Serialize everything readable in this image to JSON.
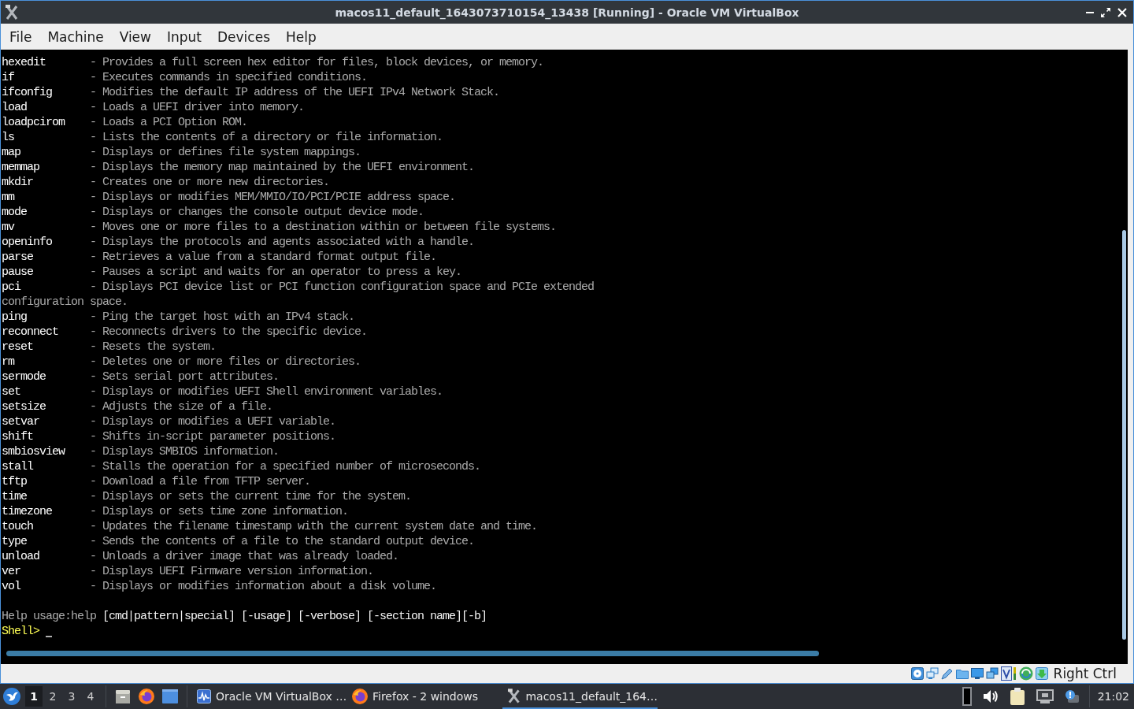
{
  "window": {
    "title": "macos11_default_1643073710154_13438 [Running] - Oracle VM VirtualBox"
  },
  "menu": [
    "File",
    "Machine",
    "View",
    "Input",
    "Devices",
    "Help"
  ],
  "terminal": {
    "lines": [
      {
        "command": "hexedit",
        "description": "- Provides a full screen hex editor for files, block devices, or memory."
      },
      {
        "command": "if",
        "description": "- Executes commands in specified conditions."
      },
      {
        "command": "ifconfig",
        "description": "- Modifies the default IP address of the UEFI IPv4 Network Stack."
      },
      {
        "command": "load",
        "description": "- Loads a UEFI driver into memory."
      },
      {
        "command": "loadpcirom",
        "description": "- Loads a PCI Option ROM."
      },
      {
        "command": "ls",
        "description": "- Lists the contents of a directory or file information."
      },
      {
        "command": "map",
        "description": "- Displays or defines file system mappings."
      },
      {
        "command": "memmap",
        "description": "- Displays the memory map maintained by the UEFI environment."
      },
      {
        "command": "mkdir",
        "description": "- Creates one or more new directories."
      },
      {
        "command": "mm",
        "description": "- Displays or modifies MEM/MMIO/IO/PCI/PCIE address space."
      },
      {
        "command": "mode",
        "description": "- Displays or changes the console output device mode."
      },
      {
        "command": "mv",
        "description": "- Moves one or more files to a destination within or between file systems."
      },
      {
        "command": "openinfo",
        "description": "- Displays the protocols and agents associated with a handle."
      },
      {
        "command": "parse",
        "description": "- Retrieves a value from a standard format output file."
      },
      {
        "command": "pause",
        "description": "- Pauses a script and waits for an operator to press a key."
      },
      {
        "command": "pci",
        "description": "- Displays PCI device list or PCI function configuration space and PCIe extended",
        "continuation": "configuration space."
      },
      {
        "command": "ping",
        "description": "- Ping the target host with an IPv4 stack."
      },
      {
        "command": "reconnect",
        "description": "- Reconnects drivers to the specific device."
      },
      {
        "command": "reset",
        "description": "- Resets the system."
      },
      {
        "command": "rm",
        "description": "- Deletes one or more files or directories."
      },
      {
        "command": "sermode",
        "description": "- Sets serial port attributes."
      },
      {
        "command": "set",
        "description": "- Displays or modifies UEFI Shell environment variables."
      },
      {
        "command": "setsize",
        "description": "- Adjusts the size of a file."
      },
      {
        "command": "setvar",
        "description": "- Displays or modifies a UEFI variable."
      },
      {
        "command": "shift",
        "description": "- Shifts in-script parameter positions."
      },
      {
        "command": "smbiosview",
        "description": "- Displays SMBIOS information."
      },
      {
        "command": "stall",
        "description": "- Stalls the operation for a specified number of microseconds."
      },
      {
        "command": "tftp",
        "description": "- Download a file from TFTP server."
      },
      {
        "command": "time",
        "description": "- Displays or sets the current time for the system."
      },
      {
        "command": "timezone",
        "description": "- Displays or sets time zone information."
      },
      {
        "command": "touch",
        "description": "- Updates the filename timestamp with the current system date and time."
      },
      {
        "command": "type",
        "description": "- Sends the contents of a file to the standard output device."
      },
      {
        "command": "unload",
        "description": "- Unloads a driver image that was already loaded."
      },
      {
        "command": "ver",
        "description": "- Displays UEFI Firmware version information."
      },
      {
        "command": "vol",
        "description": "- Displays or modifies information about a disk volume."
      }
    ],
    "usage": {
      "label": "Help usage:help",
      "syntax": "[cmd|pattern|special] [-usage] [-verbose] [-section name][-b]"
    },
    "prompt": "Shell>"
  },
  "status_bar": {
    "host_key": "Right Ctrl"
  },
  "taskbar": {
    "workspaces": [
      {
        "label": "1",
        "selected": true
      },
      {
        "label": "2",
        "selected": false
      },
      {
        "label": "3",
        "selected": false
      },
      {
        "label": "4",
        "selected": false
      }
    ],
    "tasks": [
      {
        "label": "Oracle VM VirtualBox …",
        "kind": "virtualbox",
        "selected": false
      },
      {
        "label": "Firefox - 2 windows",
        "kind": "firefox",
        "selected": false
      },
      {
        "label": "macos11_default_164…",
        "kind": "vm",
        "selected": true
      }
    ],
    "clock": "21:02"
  }
}
